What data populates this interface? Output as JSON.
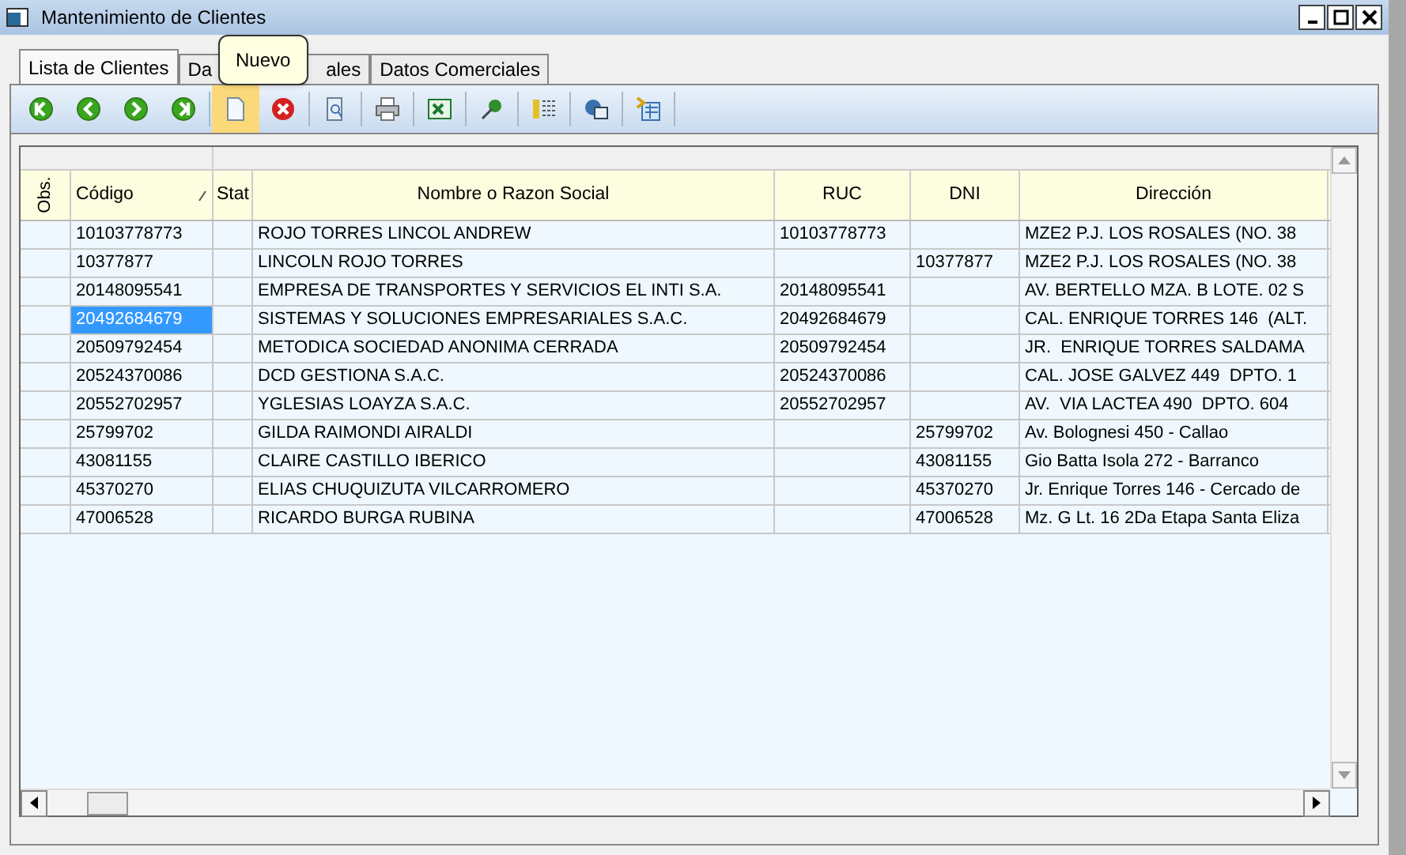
{
  "window": {
    "title": "Mantenimiento de Clientes"
  },
  "tabs": [
    {
      "label": "Lista de Clientes",
      "selected": true
    },
    {
      "label_start": "Da",
      "label_end": "ales",
      "selected": false
    },
    {
      "label": "Datos Comerciales",
      "selected": false
    }
  ],
  "toolbar": [
    {
      "kind": "first",
      "hovered": false
    },
    {
      "kind": "prev",
      "hovered": false
    },
    {
      "kind": "next",
      "hovered": false
    },
    {
      "kind": "last",
      "hovered": false
    },
    {
      "kind": "new",
      "hovered": true
    },
    {
      "kind": "delete",
      "hovered": false
    },
    {
      "kind": "preview",
      "hovered": false
    },
    {
      "kind": "print",
      "hovered": false
    },
    {
      "kind": "excel",
      "hovered": false
    },
    {
      "kind": "pin",
      "hovered": false
    },
    {
      "kind": "columns",
      "hovered": false
    },
    {
      "kind": "web",
      "hovered": false
    },
    {
      "kind": "export",
      "hovered": false
    }
  ],
  "tooltip": "Nuevo",
  "table": {
    "columns": [
      "Obs.",
      "Código",
      "Stat",
      "Nombre o Razon Social",
      "RUC",
      "DNI",
      "Dirección"
    ],
    "rows": [
      {
        "cells": [
          "",
          "10103778773",
          "",
          "ROJO TORRES LINCOL ANDREW",
          "10103778773",
          "",
          "MZE2 P.J. LOS ROSALES (NO. 38"
        ],
        "selected": false
      },
      {
        "cells": [
          "",
          "10377877",
          "",
          "LINCOLN ROJO TORRES",
          "",
          "10377877",
          "MZE2 P.J. LOS ROSALES (NO. 38"
        ],
        "selected": false
      },
      {
        "cells": [
          "",
          "20148095541",
          "",
          "EMPRESA DE TRANSPORTES Y SERVICIOS EL INTI S.A.",
          "20148095541",
          "",
          "AV. BERTELLO MZA. B LOTE. 02 S"
        ],
        "selected": false
      },
      {
        "cells": [
          "",
          "20492684679",
          "",
          "SISTEMAS Y SOLUCIONES EMPRESARIALES S.A.C.",
          "20492684679",
          "",
          "CAL. ENRIQUE TORRES 146  (ALT."
        ],
        "selected": true
      },
      {
        "cells": [
          "",
          "20509792454",
          "",
          "METODICA SOCIEDAD ANONIMA CERRADA",
          "20509792454",
          "",
          "JR.  ENRIQUE TORRES SALDAMA"
        ],
        "selected": false
      },
      {
        "cells": [
          "",
          "20524370086",
          "",
          "DCD GESTIONA S.A.C.",
          "20524370086",
          "",
          "CAL. JOSE GALVEZ 449  DPTO. 1"
        ],
        "selected": false
      },
      {
        "cells": [
          "",
          "20552702957",
          "",
          "YGLESIAS LOAYZA S.A.C.",
          "20552702957",
          "",
          "AV.  VIA LACTEA 490  DPTO. 604"
        ],
        "selected": false
      },
      {
        "cells": [
          "",
          "25799702",
          "",
          "GILDA RAIMONDI AIRALDI",
          "",
          "25799702",
          "Av. Bolognesi 450 - Callao"
        ],
        "selected": false
      },
      {
        "cells": [
          "",
          "43081155",
          "",
          "CLAIRE CASTILLO IBERICO",
          "",
          "43081155",
          "Gio Batta Isola 272 - Barranco"
        ],
        "selected": false
      },
      {
        "cells": [
          "",
          "45370270",
          "",
          "ELIAS CHUQUIZUTA VILCARROMERO",
          "",
          "45370270",
          "Jr. Enrique Torres 146 - Cercado de"
        ],
        "selected": false
      },
      {
        "cells": [
          "",
          "47006528",
          "",
          "RICARDO BURGA RUBINA",
          "",
          "47006528",
          "Mz. G Lt. 16 2Da Etapa Santa Eliza"
        ],
        "selected": false
      }
    ]
  }
}
